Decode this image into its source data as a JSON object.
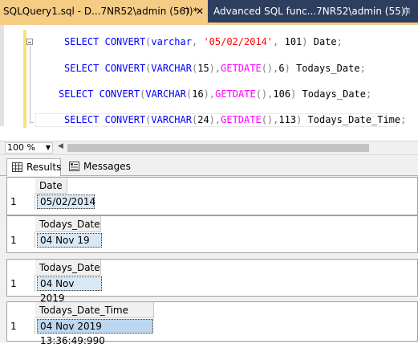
{
  "tabs": [
    {
      "label": "SQLQuery1.sql - D...7NR52\\admin (56))*",
      "pin": "⊓",
      "close": "✕"
    },
    {
      "label": "Advanced SQL func...7NR52\\admin (55))",
      "pin": "⊓"
    }
  ],
  "editor": {
    "lines": [
      [
        {
          "t": "SELECT",
          "c": "kw"
        },
        {
          "t": " "
        },
        {
          "t": "CONVERT",
          "c": "kw"
        },
        {
          "t": "(",
          "c": "op"
        },
        {
          "t": "varchar",
          "c": "kw"
        },
        {
          "t": ", ",
          "c": "op"
        },
        {
          "t": "'05/02/2014'",
          "c": "str"
        },
        {
          "t": ", ",
          "c": "op"
        },
        {
          "t": "101"
        },
        {
          "t": ")",
          "c": "op"
        },
        {
          "t": " Date"
        },
        {
          "t": ";",
          "c": "op"
        }
      ],
      [
        {
          "t": "SELECT",
          "c": "kw"
        },
        {
          "t": " "
        },
        {
          "t": "CONVERT",
          "c": "kw"
        },
        {
          "t": "(",
          "c": "op"
        },
        {
          "t": "VARCHAR",
          "c": "kw"
        },
        {
          "t": "(",
          "c": "op"
        },
        {
          "t": "15"
        },
        {
          "t": "),",
          "c": "op"
        },
        {
          "t": "GETDATE",
          "c": "fn"
        },
        {
          "t": "(),",
          "c": "op"
        },
        {
          "t": "6"
        },
        {
          "t": ")",
          "c": "op"
        },
        {
          "t": " Todays_Date"
        },
        {
          "t": ";",
          "c": "op"
        }
      ],
      [
        {
          "t": "SELECT",
          "c": "kw"
        },
        {
          "t": " "
        },
        {
          "t": "CONVERT",
          "c": "kw"
        },
        {
          "t": "(",
          "c": "op"
        },
        {
          "t": "VARCHAR",
          "c": "kw"
        },
        {
          "t": "(",
          "c": "op"
        },
        {
          "t": "16"
        },
        {
          "t": "),",
          "c": "op"
        },
        {
          "t": "GETDATE",
          "c": "fn"
        },
        {
          "t": "(),",
          "c": "op"
        },
        {
          "t": "106"
        },
        {
          "t": ")",
          "c": "op"
        },
        {
          "t": " Todays_Date"
        },
        {
          "t": ";",
          "c": "op"
        }
      ],
      [
        {
          "t": "SELECT",
          "c": "kw"
        },
        {
          "t": " "
        },
        {
          "t": "CONVERT",
          "c": "kw"
        },
        {
          "t": "(",
          "c": "op"
        },
        {
          "t": "VARCHAR",
          "c": "kw"
        },
        {
          "t": "(",
          "c": "op"
        },
        {
          "t": "24"
        },
        {
          "t": "),",
          "c": "op"
        },
        {
          "t": "GETDATE",
          "c": "fn"
        },
        {
          "t": "(),",
          "c": "op"
        },
        {
          "t": "113"
        },
        {
          "t": ")",
          "c": "op"
        },
        {
          "t": " Todays_Date_Time"
        },
        {
          "t": ";",
          "c": "op"
        }
      ]
    ]
  },
  "zoom": {
    "value": "100 %"
  },
  "results_tabs": {
    "results": "Results",
    "messages": "Messages"
  },
  "grids": [
    {
      "header": "Date",
      "row": "1",
      "value": "05/02/2014"
    },
    {
      "header": "Todays_Date",
      "row": "1",
      "value": "04 Nov 19"
    },
    {
      "header": "Todays_Date",
      "row": "1",
      "value": "04 Nov 2019"
    },
    {
      "header": "Todays_Date_Time",
      "row": "1",
      "value": "04 Nov 2019 13:36:49:990"
    }
  ],
  "colors": {
    "active_tab": "#f5cc84",
    "tab_strip": "#2d3e5e",
    "keyword": "#0000ff",
    "function": "#ff00ff",
    "string": "#ff0000",
    "selected_cell": "#d9e8f5"
  }
}
